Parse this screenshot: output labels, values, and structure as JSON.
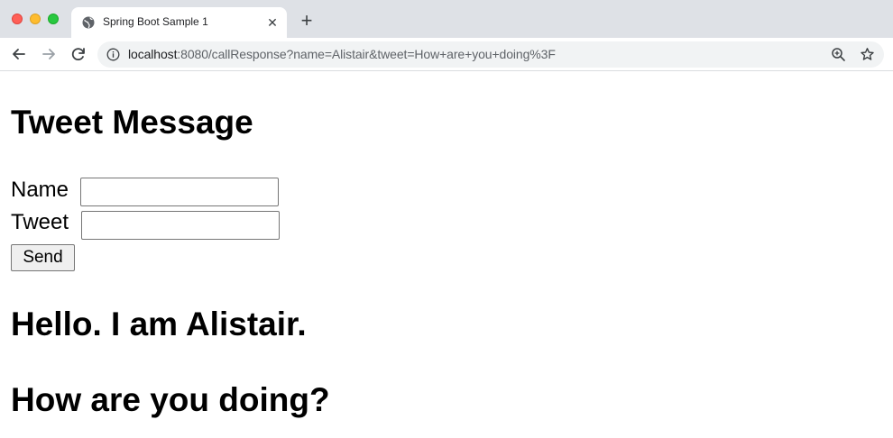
{
  "browser": {
    "tab_title": "Spring Boot Sample 1",
    "close_glyph": "✕",
    "new_tab_glyph": "+",
    "url_host": "localhost",
    "url_rest": ":8080/callResponse?name=Alistair&tweet=How+are+you+doing%3F"
  },
  "page": {
    "title": "Tweet Message",
    "form": {
      "name_label": "Name",
      "name_value": "",
      "tweet_label": "Tweet",
      "tweet_value": "",
      "send_label": "Send"
    },
    "greeting": "Hello. I am Alistair.",
    "tweet_text": "How are you doing?"
  }
}
